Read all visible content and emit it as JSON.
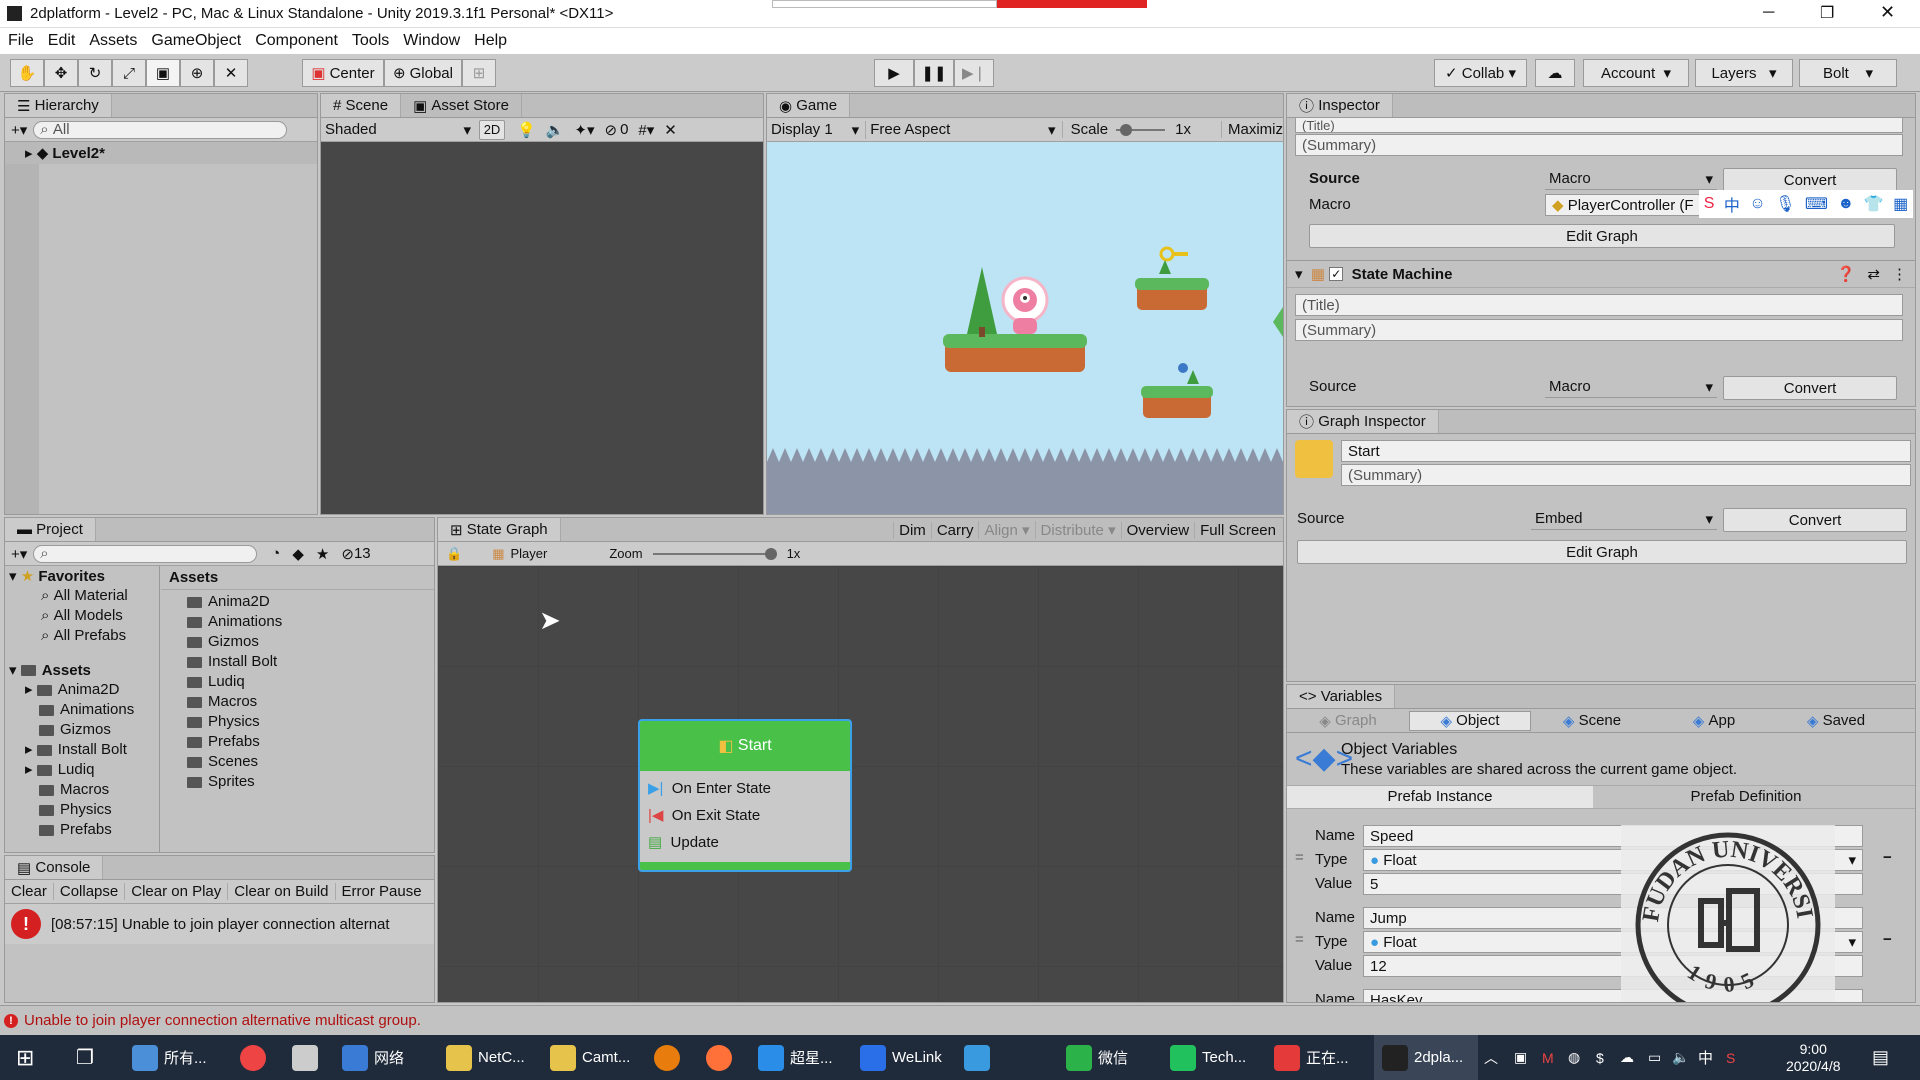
{
  "window": {
    "title": "2dplatform - Level2 - PC, Mac & Linux Standalone - Unity 2019.3.1f1 Personal* <DX11>"
  },
  "menu": [
    "File",
    "Edit",
    "Assets",
    "GameObject",
    "Component",
    "Tools",
    "Window",
    "Help"
  ],
  "toolbar": {
    "pivot": "Center",
    "space": "Global",
    "collab": "Collab",
    "account": "Account",
    "layers": "Layers",
    "layout": "Bolt"
  },
  "hierarchy": {
    "tab": "Hierarchy",
    "search_placeholder": "All",
    "scene": "Level2*"
  },
  "scene": {
    "tab_scene": "Scene",
    "tab_store": "Asset Store",
    "shading": "Shaded",
    "mode2d": "2D",
    "hidden_count": "0"
  },
  "game": {
    "tab": "Game",
    "display": "Display 1",
    "aspect": "Free Aspect",
    "scale_label": "Scale",
    "scale_value": "1x",
    "maximize": "Maximiz"
  },
  "project": {
    "tab": "Project",
    "count": "13",
    "favorites_label": "Favorites",
    "favorites": [
      "All Material",
      "All Models",
      "All Prefabs"
    ],
    "assets_label": "Assets",
    "tree": [
      "Anima2D",
      "Animations",
      "Gizmos",
      "Install Bolt",
      "Ludiq",
      "Macros",
      "Physics",
      "Prefabs"
    ],
    "assets_header": "Assets",
    "assets": [
      "Anima2D",
      "Animations",
      "Gizmos",
      "Install Bolt",
      "Ludiq",
      "Macros",
      "Physics",
      "Prefabs",
      "Scenes",
      "Sprites"
    ]
  },
  "console": {
    "tab": "Console",
    "buttons": [
      "Clear",
      "Collapse",
      "Clear on Play",
      "Clear on Build",
      "Error Pause"
    ],
    "message": "[08:57:15] Unable to join player connection alternat",
    "status": "Unable to join player connection alternative multicast group."
  },
  "state_graph": {
    "tab": "State Graph",
    "object": "Player",
    "zoom_label": "Zoom",
    "zoom_value": "1x",
    "buttons": [
      "Dim",
      "Carry",
      "Align",
      "Distribute",
      "Overview",
      "Full Screen"
    ],
    "node": {
      "title": "Start",
      "items": [
        "On Enter State",
        "On Exit State",
        "Update"
      ]
    }
  },
  "inspector": {
    "tab": "Inspector",
    "title_placeholder": "(Title)",
    "summary_placeholder": "(Summary)",
    "source_label": "Source",
    "source_value": "Macro",
    "convert": "Convert",
    "macro_label": "Macro",
    "macro_value": "PlayerController (F",
    "edit_graph": "Edit Graph",
    "state_machine": "State Machine",
    "sm_source_value": "Macro"
  },
  "graph_inspector": {
    "tab": "Graph Inspector",
    "name": "Start",
    "summary": "(Summary)",
    "source_label": "Source",
    "source_value": "Embed",
    "convert": "Convert",
    "edit_graph": "Edit Graph"
  },
  "variables": {
    "tab": "Variables",
    "tabs": [
      "Graph",
      "Object",
      "Scene",
      "App",
      "Saved"
    ],
    "heading": "Object Variables",
    "desc": "These variables are shared across the current game object.",
    "sub_tabs": [
      "Prefab Instance",
      "Prefab Definition"
    ],
    "name_label": "Name",
    "type_label": "Type",
    "value_label": "Value",
    "vars": [
      {
        "name": "Speed",
        "type": "Float",
        "value": "5"
      },
      {
        "name": "Jump",
        "type": "Float",
        "value": "12"
      },
      {
        "name": "HasKey"
      }
    ]
  },
  "watermark": {
    "top": "FUDAN UNIVERSITY",
    "year": "1905"
  },
  "taskbar": {
    "items": [
      "所有...",
      "网络",
      "NetC...",
      "Camt...",
      "超星...",
      "WeLink",
      "微信",
      "Tech...",
      "正在...",
      "2dpla..."
    ],
    "time": "9:00",
    "date": "2020/4/8",
    "ime": "中"
  }
}
